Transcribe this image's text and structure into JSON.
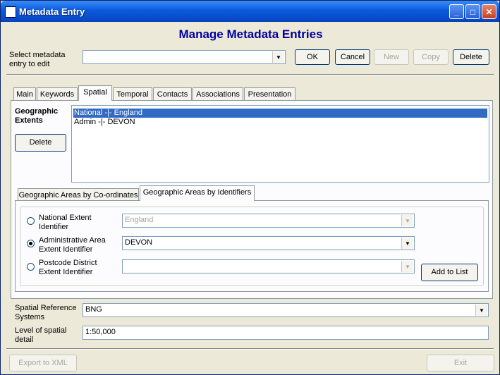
{
  "window": {
    "title": "Metadata Entry"
  },
  "heading": "Manage Metadata Entries",
  "top": {
    "select_label": "Select metadata entry to edit",
    "select_value": "",
    "ok": "OK",
    "cancel": "Cancel",
    "new": "New",
    "copy": "Copy",
    "delete": "Delete"
  },
  "tabs": [
    "Main",
    "Keywords",
    "Spatial",
    "Temporal",
    "Contacts",
    "Associations",
    "Presentation"
  ],
  "active_tab": "Spatial",
  "spatial": {
    "extents_label": "Geographic Extents",
    "delete": "Delete",
    "extents": [
      "National -|- England",
      "Admin -|- DEVON"
    ],
    "subtabs": [
      "Geographic Areas by Co-ordinates",
      "Geographic Areas by Identifiers"
    ],
    "active_subtab": "Geographic Areas by Identifiers",
    "national_label": "National Extent Identifier",
    "national_value": "England",
    "admin_label": "Administrative Area Extent Identifier",
    "admin_value": "DEVON",
    "postcode_label": "Postcode District Extent Identifier",
    "postcode_value": "",
    "add_to_list": "Add to List",
    "srs_label": "Spatial Reference Systems",
    "srs_value": "BNG",
    "level_label": "Level of spatial detail",
    "level_value": "1:50,000"
  },
  "bottom": {
    "export": "Export to XML",
    "exit": "Exit"
  }
}
